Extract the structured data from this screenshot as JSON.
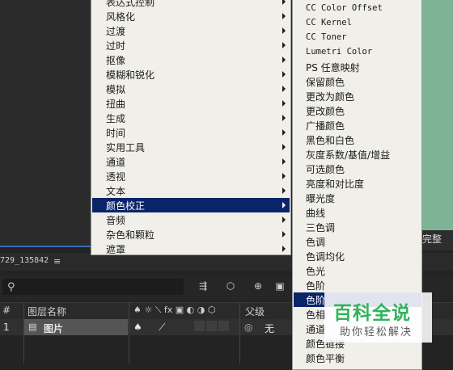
{
  "left_menu": {
    "items": [
      {
        "label": "表达式控制",
        "has_sub": true
      },
      {
        "label": "风格化",
        "has_sub": true
      },
      {
        "label": "过渡",
        "has_sub": true
      },
      {
        "label": "过时",
        "has_sub": true
      },
      {
        "label": "抠像",
        "has_sub": true
      },
      {
        "label": "模糊和锐化",
        "has_sub": true
      },
      {
        "label": "模拟",
        "has_sub": true
      },
      {
        "label": "扭曲",
        "has_sub": true
      },
      {
        "label": "生成",
        "has_sub": true
      },
      {
        "label": "时间",
        "has_sub": true
      },
      {
        "label": "实用工具",
        "has_sub": true
      },
      {
        "label": "通道",
        "has_sub": true
      },
      {
        "label": "透视",
        "has_sub": true
      },
      {
        "label": "文本",
        "has_sub": true
      },
      {
        "label": "颜色校正",
        "has_sub": true,
        "selected": true
      },
      {
        "label": "音频",
        "has_sub": true
      },
      {
        "label": "杂色和颗粒",
        "has_sub": true
      },
      {
        "label": "遮罩",
        "has_sub": true
      }
    ]
  },
  "right_menu": {
    "items": [
      {
        "label": "CC Color Offset"
      },
      {
        "label": "CC Kernel"
      },
      {
        "label": "CC Toner"
      },
      {
        "label": "Lumetri Color"
      },
      {
        "label": "PS 任意映射"
      },
      {
        "label": "保留颜色"
      },
      {
        "label": "更改为颜色"
      },
      {
        "label": "更改颜色"
      },
      {
        "label": "广播颜色"
      },
      {
        "label": "黑色和白色"
      },
      {
        "label": "灰度系数/基值/增益"
      },
      {
        "label": "可选颜色"
      },
      {
        "label": "亮度和对比度"
      },
      {
        "label": "曝光度"
      },
      {
        "label": "曲线"
      },
      {
        "label": "三色调"
      },
      {
        "label": "色调"
      },
      {
        "label": "色调均化"
      },
      {
        "label": "色光"
      },
      {
        "label": "色阶"
      },
      {
        "label": "色阶",
        "selected": true
      },
      {
        "label": "色相"
      },
      {
        "label": "通道"
      },
      {
        "label": "颜色链接"
      },
      {
        "label": "颜色平衡"
      }
    ]
  },
  "timeline": {
    "comp_tab": "729_135842",
    "search_placeholder": "",
    "columns": {
      "num": "#",
      "layer_name": "图层名称",
      "parent": "父级"
    },
    "layer": {
      "index": "1",
      "name": "图片",
      "parent_value": "无"
    }
  },
  "comp_panel": {
    "label": "完整"
  },
  "watermark": {
    "title": "百科全说",
    "subtitle": "助你轻松解决"
  },
  "colors": {
    "selection": "#0a246a",
    "menu_bg": "#f0efe9",
    "comp_bg": "#7fb396",
    "watermark_green": "#2fb45a"
  }
}
